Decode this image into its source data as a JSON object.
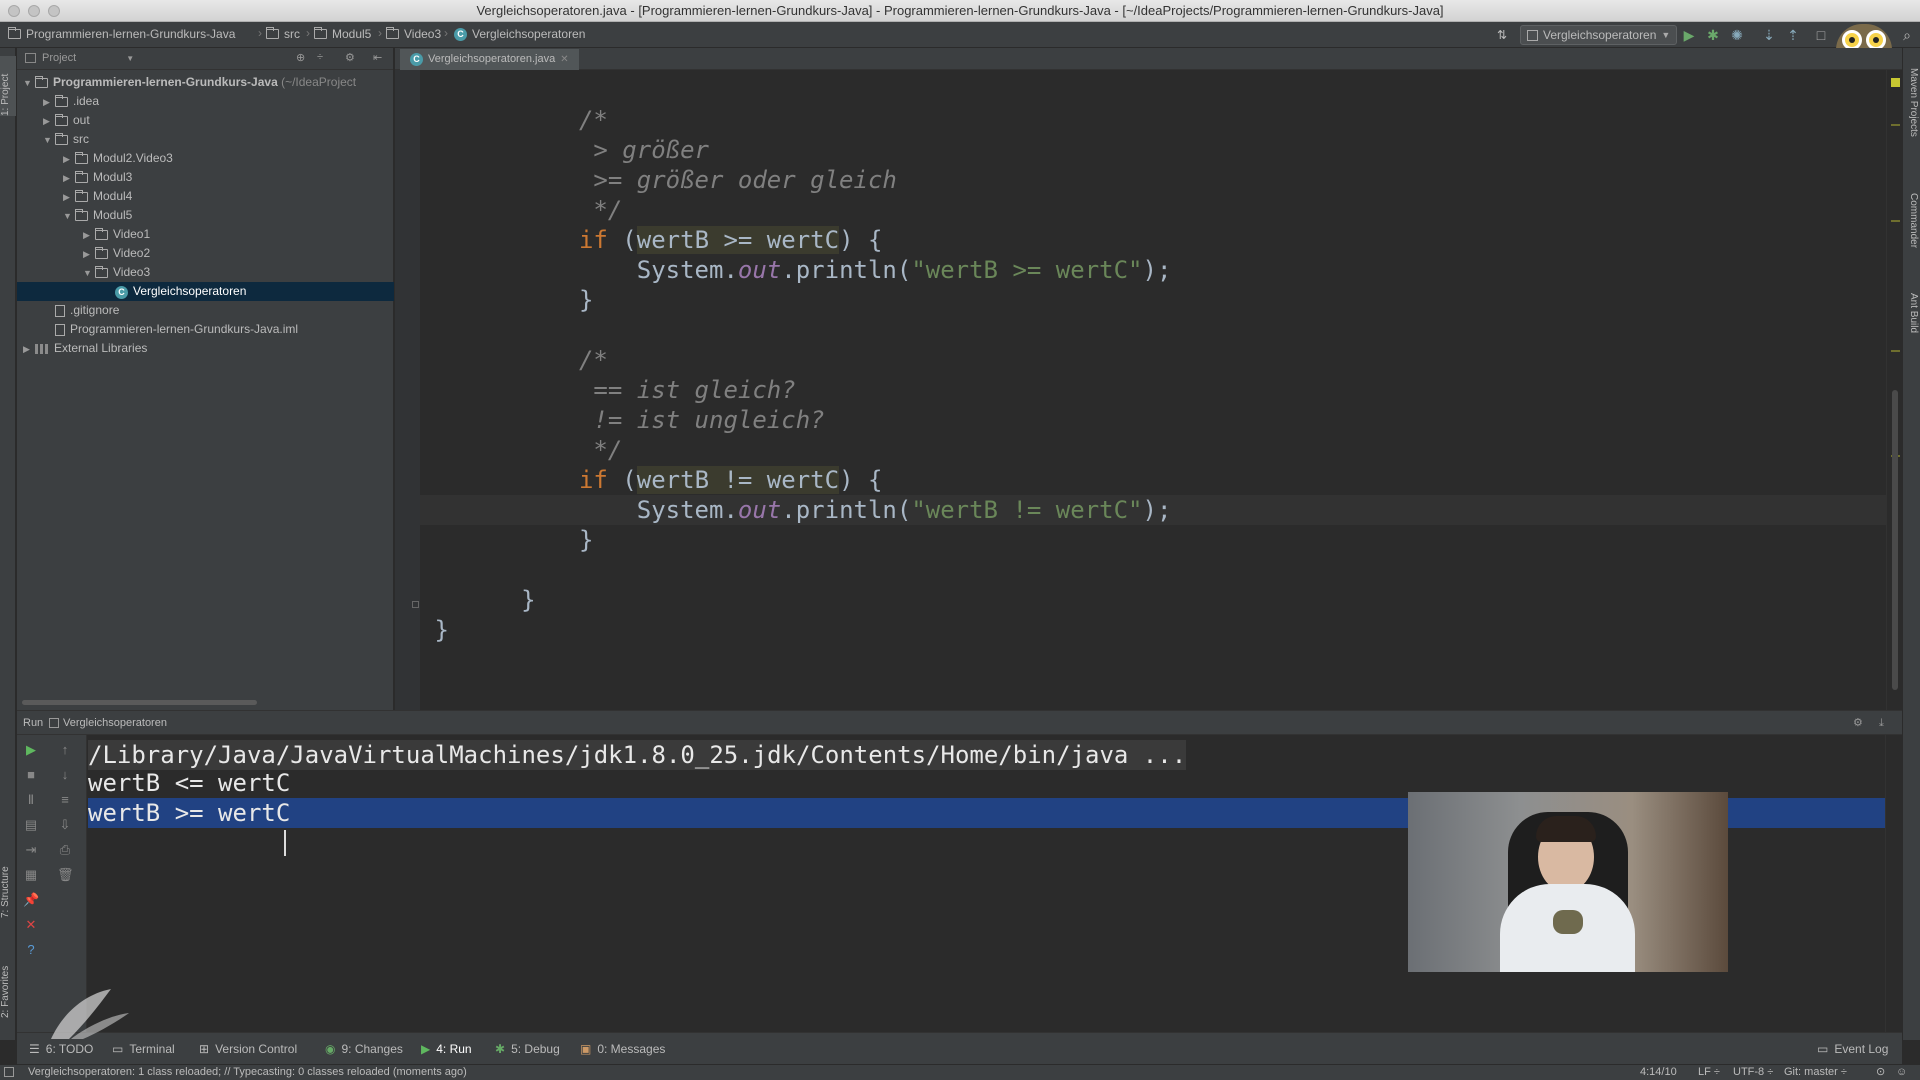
{
  "window": {
    "title": "Vergleichsoperatoren.java - [Programmieren-lernen-Grundkurs-Java] - Programmieren-lernen-Grundkurs-Java - [~/IdeaProjects/Programmieren-lernen-Grundkurs-Java]"
  },
  "breadcrumbs": [
    "Programmieren-lernen-Grundkurs-Java",
    "src",
    "Modul5",
    "Video3",
    "Vergleichsoperatoren"
  ],
  "toolbar": {
    "run_config": "Vergleichsoperatoren"
  },
  "project_panel": {
    "header": "Project",
    "tree": [
      {
        "label": "Programmieren-lernen-Grundkurs-Java",
        "suffix": " (~/IdeaProject",
        "level": 0,
        "expanded": true,
        "kind": "module"
      },
      {
        "label": ".idea",
        "level": 1,
        "expanded": false,
        "kind": "folder"
      },
      {
        "label": "out",
        "level": 1,
        "expanded": false,
        "kind": "folder"
      },
      {
        "label": "src",
        "level": 1,
        "expanded": true,
        "kind": "folder"
      },
      {
        "label": "Modul2.Video3",
        "level": 2,
        "expanded": false,
        "kind": "folder"
      },
      {
        "label": "Modul3",
        "level": 2,
        "expanded": false,
        "kind": "folder"
      },
      {
        "label": "Modul4",
        "level": 2,
        "expanded": false,
        "kind": "folder"
      },
      {
        "label": "Modul5",
        "level": 2,
        "expanded": true,
        "kind": "folder"
      },
      {
        "label": "Video1",
        "level": 3,
        "expanded": false,
        "kind": "folder"
      },
      {
        "label": "Video2",
        "level": 3,
        "expanded": false,
        "kind": "folder"
      },
      {
        "label": "Video3",
        "level": 3,
        "expanded": true,
        "kind": "folder"
      },
      {
        "label": "Vergleichsoperatoren",
        "level": 4,
        "kind": "class",
        "selected": true
      },
      {
        "label": ".gitignore",
        "level": 1,
        "kind": "file"
      },
      {
        "label": "Programmieren-lernen-Grundkurs-Java.iml",
        "level": 1,
        "kind": "file"
      },
      {
        "label": "External Libraries",
        "level": 0,
        "expanded": false,
        "kind": "library"
      }
    ]
  },
  "editor": {
    "tab_label": "Vergleichsoperatoren.java",
    "lines": {
      "l1": "/*",
      "l2": " > größer",
      "l3": " >= größer oder gleich",
      "l4": " */",
      "l5_kw": "if",
      "l5_a": " (",
      "l5_hl": "wertB >= wertC",
      "l5_b": ") {",
      "l6_a": "    System.",
      "l6_out": "out",
      "l6_b": ".println(",
      "l6_str": "\"wertB >= wertC\"",
      "l6_c": ");",
      "l7": "}",
      "l8": "/*",
      "l9": " == ist gleich?",
      "l10": " != ist ungleich?",
      "l11": " */",
      "l12_kw": "if",
      "l12_a": " (",
      "l12_hl": "wertB != wertC",
      "l12_b": ") {",
      "l13_a": "    System.",
      "l13_out": "out",
      "l13_b": ".println(",
      "l13_str": "\"wertB != wertC\"",
      "l13_c": ");",
      "l14": "}",
      "l15": "}",
      "l16": "}"
    }
  },
  "run_panel": {
    "label": "Run",
    "config": "Vergleichsoperatoren",
    "output": [
      "/Library/Java/JavaVirtualMachines/jdk1.8.0_25.jdk/Contents/Home/bin/java ...",
      "wertB <= wertC",
      "wertB >= wertC"
    ]
  },
  "sidebars": {
    "left": [
      "1: Project",
      "7: Structure",
      "2: Favorites"
    ],
    "right": [
      "Maven Projects",
      "Commander",
      "Ant Build"
    ]
  },
  "tool_windows": [
    "6: TODO",
    "Terminal",
    "Version Control",
    "9: Changes",
    "4: Run",
    "5: Debug",
    "0: Messages"
  ],
  "event_log": "Event Log",
  "status": {
    "message": "Vergleichsoperatoren: 1 class reloaded; // Typecasting: 0 classes reloaded (moments ago)",
    "position": "4:14/10",
    "line_sep": "LF ÷",
    "encoding": "UTF-8 ÷",
    "vcs": "Git: master ÷"
  },
  "colors": {
    "editor_bg": "#2b2b2b",
    "panel_bg": "#3c3f41",
    "keyword": "#cc7832",
    "string": "#6a8759",
    "comment": "#808080",
    "selection": "#214283"
  }
}
